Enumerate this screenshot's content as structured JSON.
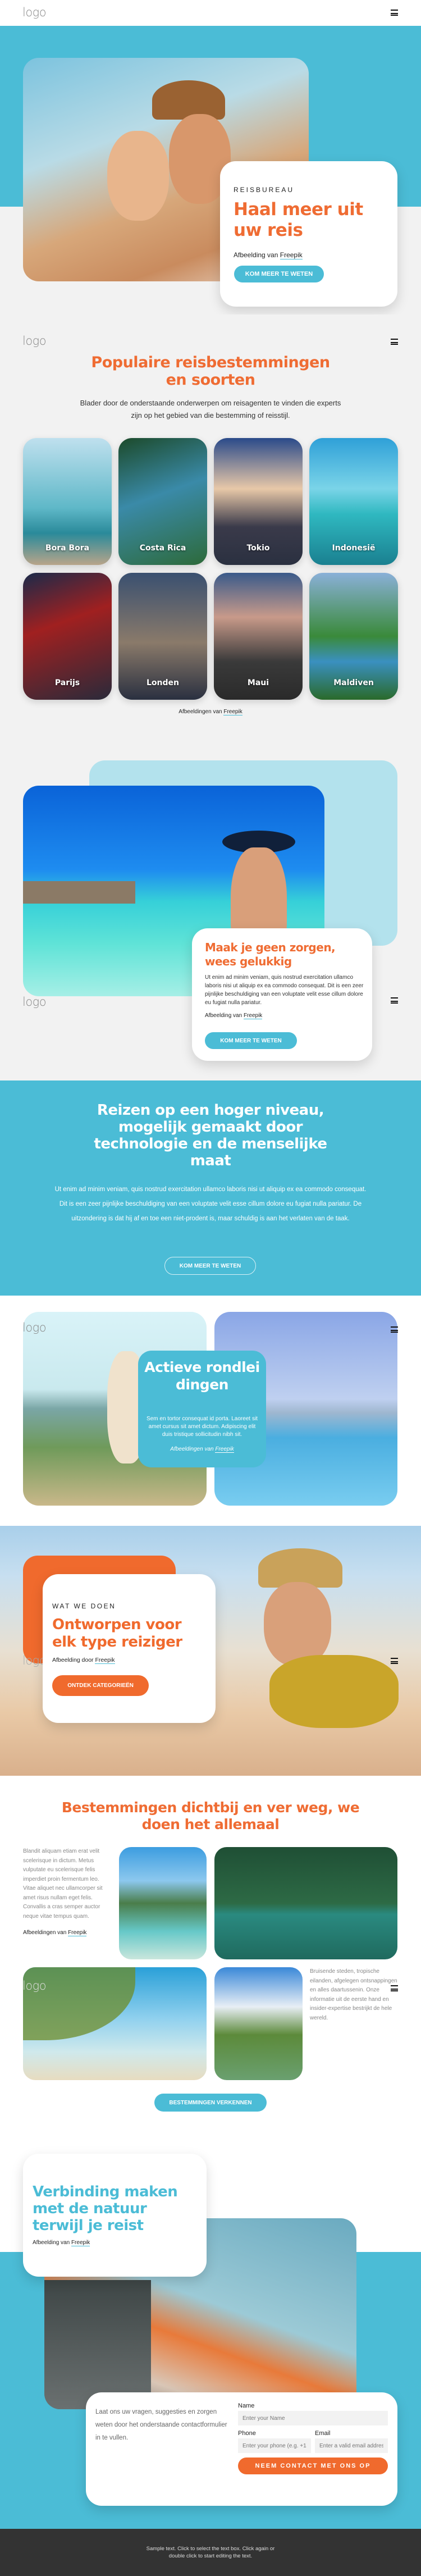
{
  "colors": {
    "accent_blue": "#4bbcd6",
    "accent_orange": "#ef6c33",
    "light_blue": "#b3e2ed",
    "light_grey": "#f2f2f2",
    "footer": "#333333"
  },
  "header": {
    "logo": "logo",
    "menu_icon": "hamburger-icon"
  },
  "hero": {
    "eyebrow": "REISBUREAU",
    "title": "Haal meer uit uw reis",
    "credit_prefix": "Afbeelding van",
    "credit_link": "Freepik",
    "button": "KOM MEER TE WETEN"
  },
  "destinations": {
    "logo": "logo",
    "title": "Populaire reisbestemmingen en soorten",
    "intro": "Blader door de onderstaande onderwerpen om reisagenten te vinden die experts zijn op het gebied van die bestemming of reisstijl.",
    "items": [
      {
        "label": "Bora Bora"
      },
      {
        "label": "Costa Rica"
      },
      {
        "label": "Tokio"
      },
      {
        "label": "Indonesië"
      },
      {
        "label": "Parijs"
      },
      {
        "label": "Londen"
      },
      {
        "label": "Maui"
      },
      {
        "label": "Maldiven"
      }
    ],
    "credit_prefix": "Afbeeldingen van",
    "credit_link": "Freepik"
  },
  "happy": {
    "logo": "logo",
    "title": "Maak je geen zorgen, wees gelukkig",
    "text": "Ut enim ad minim veniam, quis nostrud exercitation ullamco laboris nisi ut aliquip ex ea commodo consequat. Dit is een zeer pijnlijke beschuldiging van een voluptate velit esse cillum dolore eu fugiat nulla pariatur.",
    "credit_prefix": "Afbeelding van",
    "credit_link": "Freepik",
    "button": "KOM MEER TE WETEN"
  },
  "tech": {
    "title": "Reizen op een hoger niveau, mogelijk gemaakt door technologie en de menselijke maat",
    "text": "Ut enim ad minim veniam, quis nostrud exercitation ullamco laboris nisi ut aliquip ex ea commodo consequat. Dit is een zeer pijnlijke beschuldiging van een voluptate velit esse cillum dolore eu fugiat nulla pariatur. De uitzondering is dat hij af en toe een niet-prodent is, maar schuldig is aan het verlaten van de taak.",
    "button": "KOM MEER TE WETEN"
  },
  "active": {
    "logo": "logo",
    "title": "Actieve rondleidingen",
    "text": "Sem en tortor consequat id porta. Laoreet sit amet cursus sit amet dictum. Adipiscing elit duis tristique sollicitudin nibh sit.",
    "credit_prefix": "Afbeeldingen van",
    "credit_link": "Freepik"
  },
  "what": {
    "logo": "logo",
    "eyebrow": "WAT WE DOEN",
    "title": "Ontworpen voor elk type reiziger",
    "credit_prefix": "Afbeelding door",
    "credit_link": "Freepik",
    "button": "ONTDEK CATEGORIEËN"
  },
  "near": {
    "logo": "logo",
    "title": "Bestemmingen dichtbij en ver weg, we doen het allemaal",
    "text_left": "Blandit aliquam etiam erat velit scelerisque in dictum. Metus vulputate eu scelerisque felis imperdiet proin fermentum leo. Vitae aliquet nec ullamcorper sit amet risus nullam eget felis. Convallis a cras semper auctor neque vitae tempus quam.",
    "credit_prefix": "Afbeeldingen van",
    "credit_link": "Freepik",
    "text_right": "Bruisende steden, tropische eilanden, afgelegen ontsnappingen en alles daartussenin. Onze informatie uit de eerste hand en insider-expertise bestrijkt de hele wereld.",
    "button": "BESTEMMINGEN VERKENNEN"
  },
  "nature": {
    "title": "Verbinding maken met de natuur terwijl je reist",
    "credit_prefix": "Afbeelding van",
    "credit_link": "Freepik"
  },
  "contact": {
    "text": "Laat ons uw vragen, suggesties en zorgen weten door het onderstaande contactformulier in te vullen.",
    "name_label": "Name",
    "name_placeholder": "Enter your Name",
    "phone_label": "Phone",
    "phone_placeholder": "Enter your phone (e.g. +14",
    "email_label": "Email",
    "email_placeholder": "Enter a valid email address",
    "button": "NEEM CONTACT MET ONS OP"
  },
  "footer": {
    "text": "Sample text. Click to select the text box. Click again or double click to start editing the text."
  }
}
